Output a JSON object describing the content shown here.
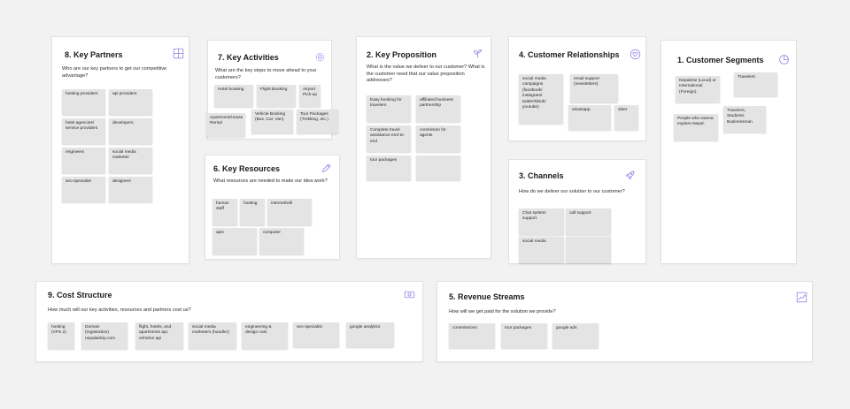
{
  "colors": {
    "background": "#f2f2f2",
    "card": "#ffffff",
    "sticky": "#e4e4e4",
    "icon": "#8c86e6"
  },
  "key_partners": {
    "title": "8. Key Partners",
    "question": "Who are our key partners to get our competitive advantage?",
    "icon": "grid-icon",
    "notes": [
      "hosting providers",
      "api providers",
      "hotel agencies/ service providers",
      "developers",
      "engineers",
      "social media marketer",
      "seo specialist",
      "designers"
    ]
  },
  "key_activities": {
    "title": "7. Key Activities",
    "question": "What are the key steps to move ahead to your customers?",
    "icon": "gear-icon",
    "notes": [
      "Hotel booking",
      "Flight Booking",
      "Airport Pick-up",
      "Apartment/House Rental",
      "Vehicle Booking (Bus, Car, Van)",
      "Tour Packages (Trekking, etc.)"
    ]
  },
  "key_resources": {
    "title": "6. Key Resources",
    "question": "What resources are needed to make our idea work?",
    "icon": "pencil-icon",
    "notes": [
      "human staff",
      "hosting",
      "internet/wifi",
      "apis",
      "computer"
    ]
  },
  "key_proposition": {
    "title": "2. Key Proposition",
    "question": "What is the value we deliver to our customer? What is the customer need that our value proposition addresses?",
    "icon": "plant-icon",
    "notes": [
      "Easy booking for travelers",
      "affiliated business partnership",
      "Complete travel assistance end-to-end",
      "commision for agents",
      "tour packages",
      ""
    ]
  },
  "customer_relationships": {
    "title": "4. Customer Relationships",
    "icon": "heart-icon",
    "notes": [
      "social media campaigns (facebook/ instagram/ twitter/tiktok/ youtube)",
      "email support (newsletters)",
      "whatsapp",
      "viber"
    ]
  },
  "channels": {
    "title": "3. Channels",
    "question": "How do we deliver our solution to our customer?",
    "icon": "rocket-icon",
    "notes": [
      "Chat system support",
      "call support",
      "social media",
      ""
    ]
  },
  "customer_segments": {
    "title": "1. Customer Segments",
    "icon": "pie-chart-icon",
    "notes": [
      "Nepalese (Local) or International (Foreign)",
      "Travelers",
      "People who wanna explore Nepal.",
      "Travelers, Students, Businessman"
    ]
  },
  "cost_structure": {
    "title": "9. Cost Structure",
    "question": "How much will our key activities, resources and partners cost us?",
    "icon": "money-icon",
    "notes": [
      "hosting (VPS 2)",
      "Domain (registration) nepalairtrip.com",
      "flight, hotels, and apartments api, vehicles api",
      "social media marketers (handler)",
      "engineering & design cost",
      "seo specialist",
      "google analytics"
    ]
  },
  "revenue_streams": {
    "title": "5. Revenue Streams",
    "question": "How will we get paid for the solution we provide?",
    "icon": "growth-chart-icon",
    "notes": [
      "commissions",
      "tour packages",
      "google ads"
    ]
  }
}
